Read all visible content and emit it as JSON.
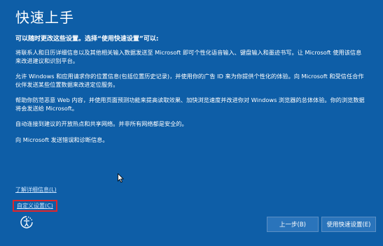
{
  "page": {
    "title": "快速上手",
    "subheading": "可以随时更改这些设置。选择“使用快速设置”可以:",
    "paragraphs": [
      "将联系人和日历详细信息以及其他相关输入数据发送至 Microsoft 即可个性化语音输入、键盘输入和墨迹书写。让 Microsoft 使用该信息来改进建议和识别平台。",
      "允许 Windows 和应用请求你的位置信息(包括位置历史记录)，并使用你的广告 ID 来为你提供个性化的体验。向 Microsoft 和受信任合作伙伴发送某些位置数据来改进定位服务。",
      "帮助你防范恶意 Web 内容，并使用页面预测功能来提高读取效果、加快浏览速度并改进你对 Windows 浏览器的总体体验。你的浏览数据将会发送给 Microsoft。",
      "自动连接到建议的开放热点和共享网络。并非所有网络都是安全的。",
      "向 Microsoft 发送错误和诊断信息。"
    ],
    "learn_more_link": "了解详细信息(L)",
    "customize_link": "自定义设置(C)",
    "back_button": "上一步(B)",
    "express_button": "使用快速设置(E)"
  },
  "icons": {
    "ease_of_access": "ease-of-access-icon",
    "cursor": "mouse-pointer-icon"
  },
  "colors": {
    "background": "#0e5ea7",
    "highlight_box": "#e0262b",
    "link": "#cfe6ff"
  }
}
